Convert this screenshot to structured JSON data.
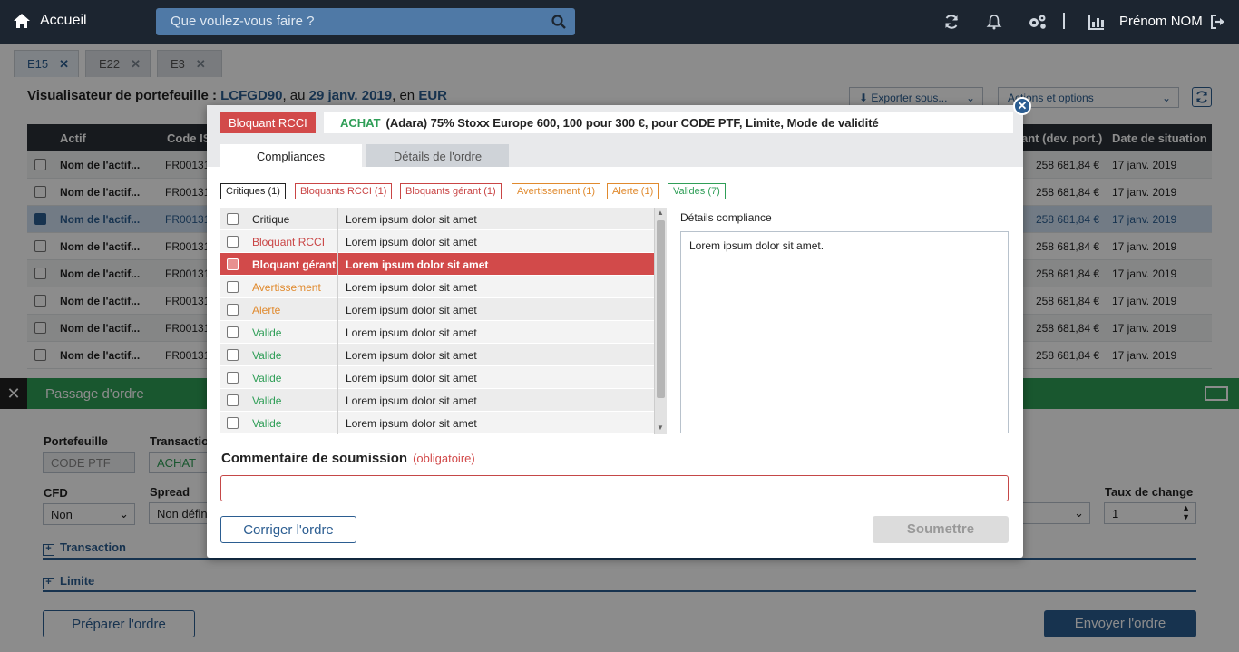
{
  "topbar": {
    "home_label": "Accueil",
    "search_placeholder": "Que voulez-vous faire ?",
    "user_name": "Prénom NOM"
  },
  "tabs": [
    {
      "label": "E15"
    },
    {
      "label": "E22"
    },
    {
      "label": "E3"
    }
  ],
  "page": {
    "title_prefix": "Visualisateur de portefeuille : ",
    "portfolio": "LCFGD90",
    "sep1": ", au ",
    "date": "29 janv. 2019",
    "sep2": ", en ",
    "currency": "EUR",
    "export_label": "Exporter sous...",
    "actions_label": "Actions et options"
  },
  "grid": {
    "headers": {
      "actif": "Actif",
      "code": "Code IS",
      "montant": "ant (dev. port.)",
      "date": "Date de situation"
    },
    "rows": [
      {
        "actif": "Nom de l'actif...",
        "code": "FR00131",
        "montant": "258 681,84 €",
        "date": "17 janv. 2019"
      },
      {
        "actif": "Nom de l'actif...",
        "code": "FR00131",
        "montant": "258 681,84 €",
        "date": "17 janv. 2019"
      },
      {
        "actif": "Nom de l'actif...",
        "code": "FR00131",
        "montant": "258 681,84 €",
        "date": "17 janv. 2019"
      },
      {
        "actif": "Nom de l'actif...",
        "code": "FR00131",
        "montant": "258 681,84 €",
        "date": "17 janv. 2019"
      },
      {
        "actif": "Nom de l'actif...",
        "code": "FR00131",
        "montant": "258 681,84 €",
        "date": "17 janv. 2019"
      },
      {
        "actif": "Nom de l'actif...",
        "code": "FR00131",
        "montant": "258 681,84 €",
        "date": "17 janv. 2019"
      },
      {
        "actif": "Nom de l'actif...",
        "code": "FR00131",
        "montant": "258 681,84 €",
        "date": "17 janv. 2019"
      },
      {
        "actif": "Nom de l'actif...",
        "code": "FR00131",
        "montant": "258 681,84 €",
        "date": "17 janv. 2019"
      }
    ]
  },
  "order": {
    "title": "Passage d'ordre",
    "portefeuille_label": "Portefeuille",
    "portefeuille_value": "CODE PTF",
    "transaction_label": "Transaction",
    "transaction_value": "ACHAT",
    "cfd_label": "CFD",
    "cfd_value": "Non",
    "spread_label": "Spread",
    "spread_value": "Non défini",
    "taux_label": "Taux de change",
    "taux_value": "1",
    "section_transaction": "Transaction",
    "section_limite": "Limite",
    "prepare_label": "Préparer l'ordre",
    "send_label": "Envoyer l'ordre"
  },
  "modal": {
    "badge": "Bloquant RCCI",
    "order_type": "ACHAT",
    "order_desc": "(Adara) 75% Stoxx Europe 600, 100 pour 300 €, pour CODE PTF, Limite, Mode de validité",
    "tab_compliances": "Compliances",
    "tab_details": "Détails de l'ordre",
    "filters": [
      {
        "label": "Critiques (1)",
        "color": "#222222"
      },
      {
        "label": "Bloquants RCCI (1)",
        "color": "#c94545"
      },
      {
        "label": "Bloquants gérant (1)",
        "color": "#c94545"
      },
      {
        "label": "Avertissement (1)",
        "color": "#e08a2e"
      },
      {
        "label": "Alerte (1)",
        "color": "#e08a2e"
      },
      {
        "label": "Valides (7)",
        "color": "#2f9e57"
      }
    ],
    "rows": [
      {
        "type": "Critique",
        "color": "#222222",
        "text": "Lorem ipsum dolor sit amet"
      },
      {
        "type": "Bloquant RCCI",
        "color": "#c94545",
        "text": "Lorem ipsum dolor sit amet"
      },
      {
        "type": "Bloquant gérant",
        "color": "#ffffff",
        "text": "Lorem ipsum dolor sit amet"
      },
      {
        "type": "Avertissement",
        "color": "#e08a2e",
        "text": "Lorem ipsum dolor sit amet"
      },
      {
        "type": "Alerte",
        "color": "#e08a2e",
        "text": "Lorem ipsum dolor sit amet"
      },
      {
        "type": "Valide",
        "color": "#2f9e57",
        "text": "Lorem ipsum dolor sit amet"
      },
      {
        "type": "Valide",
        "color": "#2f9e57",
        "text": "Lorem ipsum dolor sit amet"
      },
      {
        "type": "Valide",
        "color": "#2f9e57",
        "text": "Lorem ipsum dolor sit amet"
      },
      {
        "type": "Valide",
        "color": "#2f9e57",
        "text": "Lorem ipsum dolor sit amet"
      },
      {
        "type": "Valide",
        "color": "#2f9e57",
        "text": "Lorem ipsum dolor sit amet"
      }
    ],
    "details_label": "Détails compliance",
    "details_text": "Lorem ipsum dolor sit amet.",
    "comment_label": "Commentaire de soumission",
    "comment_required": "(obligatoire)",
    "correct_label": "Corriger l'ordre",
    "submit_label": "Soumettre"
  }
}
